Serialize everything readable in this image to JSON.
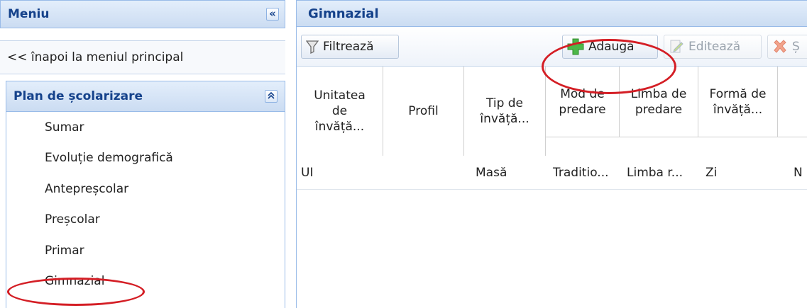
{
  "sidebar": {
    "title": "Meniu",
    "collapse_icon": "double-chevron-left-icon",
    "back_link": "<< înapoi la meniul principal",
    "section": {
      "title": "Plan de școlarizare",
      "collapse_icon": "double-chevron-up-icon",
      "items": [
        {
          "label": "Sumar"
        },
        {
          "label": "Evoluție demografică"
        },
        {
          "label": "Antepreșcolar"
        },
        {
          "label": "Preșcolar"
        },
        {
          "label": "Primar"
        },
        {
          "label": "Gimnazial"
        }
      ]
    }
  },
  "main": {
    "title": "Gimnazial",
    "toolbar": {
      "filter_label": "Filtrează",
      "add_label": "Adaugă",
      "edit_label": "Editează",
      "delete_label": "Ș"
    },
    "grid": {
      "columns": [
        {
          "line1": "Unitatea",
          "line2": "de",
          "line3": "învăță..."
        },
        {
          "line1": "Profil",
          "line2": "",
          "line3": ""
        },
        {
          "line1": "Tip de",
          "line2": "învăță...",
          "line3": ""
        },
        {
          "line1": "Mod de",
          "line2": "predare",
          "line3": ""
        },
        {
          "line1": "Limba de",
          "line2": "predare",
          "line3": ""
        },
        {
          "line1": "Formă de",
          "line2": "învăță...",
          "line3": ""
        }
      ],
      "rows": [
        [
          "UI",
          "",
          "Masă",
          "Traditio...",
          "Limba r...",
          "Zi",
          "N"
        ]
      ]
    }
  },
  "colors": {
    "header_text": "#15428b",
    "border": "#99bbe8",
    "highlight": "#d41e25"
  }
}
